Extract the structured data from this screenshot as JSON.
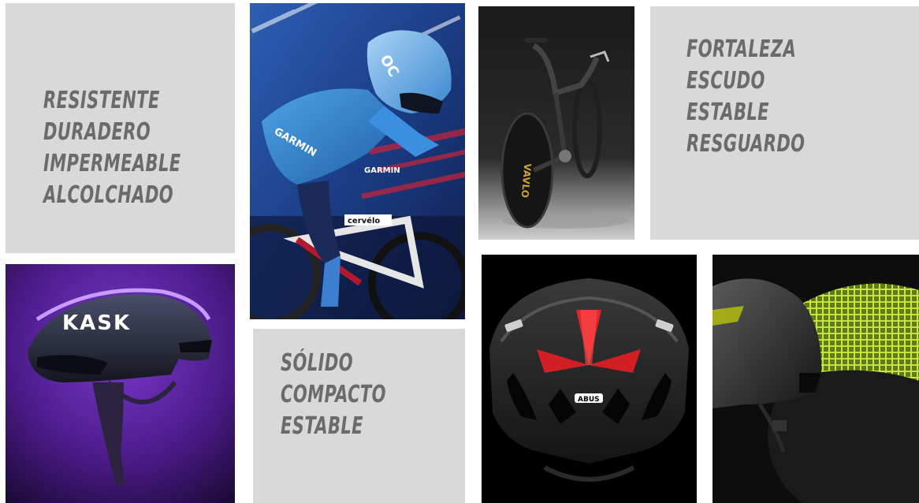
{
  "panel_1": {
    "words": [
      "RESISTENTE",
      "DURADERO",
      "IMPERMEABLE",
      "ALCOLCHADO"
    ]
  },
  "panel_2": {
    "words": [
      "FORTALEZA",
      "ESCUDO",
      "ESTABLE",
      "RESGUARDO"
    ]
  },
  "panel_3": {
    "words": [
      "SÓLIDO",
      "COMPACTO",
      "ESTABLE"
    ]
  },
  "brands": {
    "kask": "KASK",
    "garmin": "GARMIN",
    "cervelo": "cervélo",
    "abus": "ABUS",
    "bike_logo": "VAVLO"
  }
}
